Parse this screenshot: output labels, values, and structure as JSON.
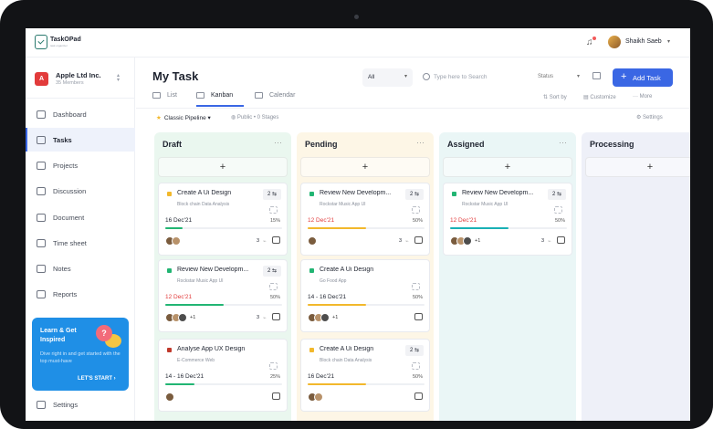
{
  "app": {
    "logo_title": "TaskOPad",
    "logo_sub": "task organizer"
  },
  "user": {
    "name": "Shaikh Saeb"
  },
  "org": {
    "initial": "A",
    "name": "Apple Ltd Inc.",
    "members": "35 Members"
  },
  "nav": [
    {
      "label": "Dashboard"
    },
    {
      "label": "Tasks",
      "active": true
    },
    {
      "label": "Projects"
    },
    {
      "label": "Discussion"
    },
    {
      "label": "Document"
    },
    {
      "label": "Time sheet"
    },
    {
      "label": "Notes"
    },
    {
      "label": "Reports"
    },
    {
      "label": "Settings"
    }
  ],
  "promo": {
    "heading": "Learn & Get Inspired",
    "body": "Dive right in and get started with the top must-have",
    "link": "LET'S START"
  },
  "header": {
    "title": "My Task",
    "filter": "All",
    "search_placeholder": "Type here to Search",
    "status": "Status",
    "add_button": "Add Task"
  },
  "tabs": [
    {
      "label": "List"
    },
    {
      "label": "Kanban",
      "active": true
    },
    {
      "label": "Calendar"
    }
  ],
  "tools": {
    "sort": "Sort by",
    "customize": "Customize",
    "more": "More"
  },
  "pipeline": {
    "name": "Classic Pipeline",
    "meta": "Public • 0 Stages",
    "settings": "Settings"
  },
  "colors": {
    "accent": "#3a67e4",
    "draft": "#eaf7ef",
    "pending": "#fdf6e6",
    "assigned": "#eaf6f6",
    "processing": "#eef0f8"
  },
  "columns": [
    {
      "title": "Draft",
      "color": "#eaf7ef",
      "cards": [
        {
          "title": "Create A Ui Design",
          "sub": "Block chain Data Analysis",
          "badge": "2",
          "date": "16 Dec'21",
          "date_red": false,
          "percent": "15%",
          "progress": 0.15,
          "bar_color": "#22b573",
          "dot": "#f2b82c",
          "more": "",
          "count": "3",
          "avatars": 2
        },
        {
          "title": "Review New Developm...",
          "sub": "Rockstar Music App UI",
          "badge": "2",
          "date": "12 Dec'21",
          "date_red": true,
          "percent": "50%",
          "progress": 0.5,
          "bar_color": "#22b573",
          "dot": "#22b573",
          "more": "+1",
          "count": "3",
          "avatars": 3
        },
        {
          "title": "Analyse App UX Design",
          "sub": "E-Commerce Web",
          "badge": "",
          "date": "14 - 16 Dec'21",
          "date_red": false,
          "percent": "25%",
          "progress": 0.25,
          "bar_color": "#22b573",
          "dot": "#c0392b",
          "more": "",
          "count": "",
          "avatars": 1
        }
      ]
    },
    {
      "title": "Pending",
      "color": "#fdf6e6",
      "cards": [
        {
          "title": "Review New Developm...",
          "sub": "Rockstar Music App UI",
          "badge": "2",
          "date": "12 Dec'21",
          "date_red": true,
          "percent": "50%",
          "progress": 0.5,
          "bar_color": "#f2b82c",
          "dot": "#22b573",
          "more": "",
          "count": "3",
          "avatars": 1
        },
        {
          "title": "Create A Ui Design",
          "sub": "Go Food App",
          "badge": "",
          "date": "14 - 16 Dec'21",
          "date_red": false,
          "percent": "50%",
          "progress": 0.5,
          "bar_color": "#f2b82c",
          "dot": "#22b573",
          "more": "+1",
          "count": "",
          "avatars": 3
        },
        {
          "title": "Create A Ui Design",
          "sub": "Block chain Data Analysis",
          "badge": "2",
          "date": "16 Dec'21",
          "date_red": false,
          "percent": "50%",
          "progress": 0.5,
          "bar_color": "#f2b82c",
          "dot": "#f2b82c",
          "more": "",
          "count": "",
          "avatars": 2
        }
      ]
    },
    {
      "title": "Assigned",
      "color": "#eaf6f6",
      "cards": [
        {
          "title": "Review New Developm...",
          "sub": "Rockstar Music App UI",
          "badge": "2",
          "date": "12 Dec'21",
          "date_red": true,
          "percent": "50%",
          "progress": 0.5,
          "bar_color": "#1ab0b5",
          "dot": "#22b573",
          "more": "+1",
          "count": "3",
          "avatars": 3
        }
      ]
    },
    {
      "title": "Processing",
      "color": "#eef0f8",
      "cards": []
    }
  ]
}
